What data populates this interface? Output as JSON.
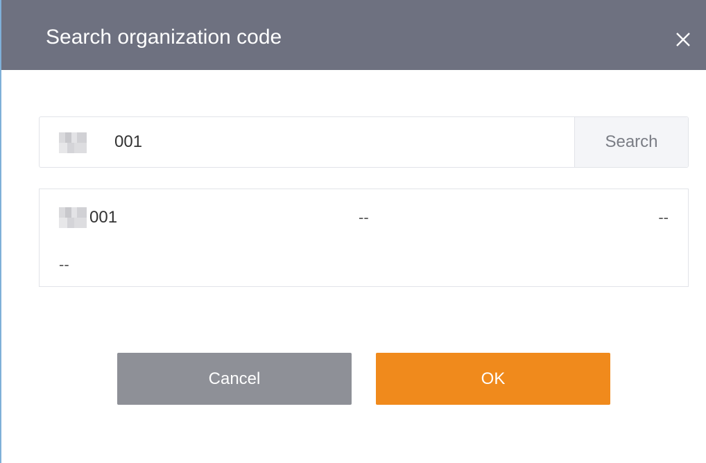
{
  "dialog": {
    "title": "Search organization code",
    "close_icon": "close-icon"
  },
  "search": {
    "input_value": "001",
    "button_label": "Search"
  },
  "result": {
    "code": "001",
    "field_1": "--",
    "field_2": "--",
    "field_3": "--"
  },
  "actions": {
    "cancel_label": "Cancel",
    "ok_label": "OK"
  },
  "colors": {
    "header": "#6e7180",
    "ok": "#f08a1c",
    "cancel": "#8e9097"
  }
}
